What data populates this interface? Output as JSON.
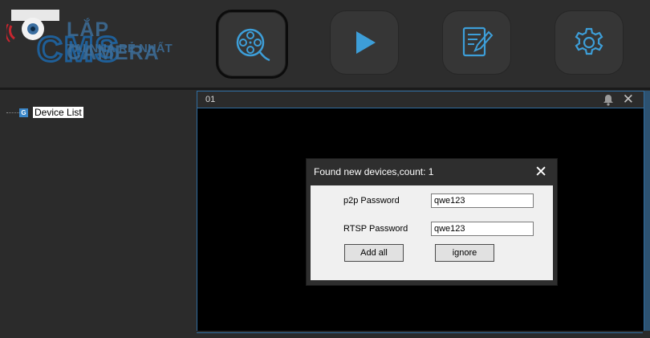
{
  "logo": {
    "brand": "LẮP CAMERA",
    "tagline": "TẠI NHÀ RẺ NHẤT"
  },
  "toolbar": {
    "buttons": [
      {
        "icon": "film-reel-icon",
        "active": true
      },
      {
        "icon": "play-icon",
        "active": false
      },
      {
        "icon": "log-edit-icon",
        "active": false
      },
      {
        "icon": "gear-icon",
        "active": false
      }
    ],
    "accent": "#3d9ed8"
  },
  "sidebar": {
    "tree": [
      {
        "icon_letter": "G",
        "label": "Device List"
      }
    ]
  },
  "video_panel": {
    "title": "01",
    "icons": [
      "bell-icon",
      "close-icon"
    ]
  },
  "dialog": {
    "title": "Found new devices,count: 1",
    "close_symbol": "✕",
    "p2p_label": "p2p Password",
    "p2p_value": "qwe123",
    "rtsp_label": "RTSP Password",
    "rtsp_value": "qwe123",
    "add_all_label": "Add all",
    "ignore_label": "ignore"
  }
}
